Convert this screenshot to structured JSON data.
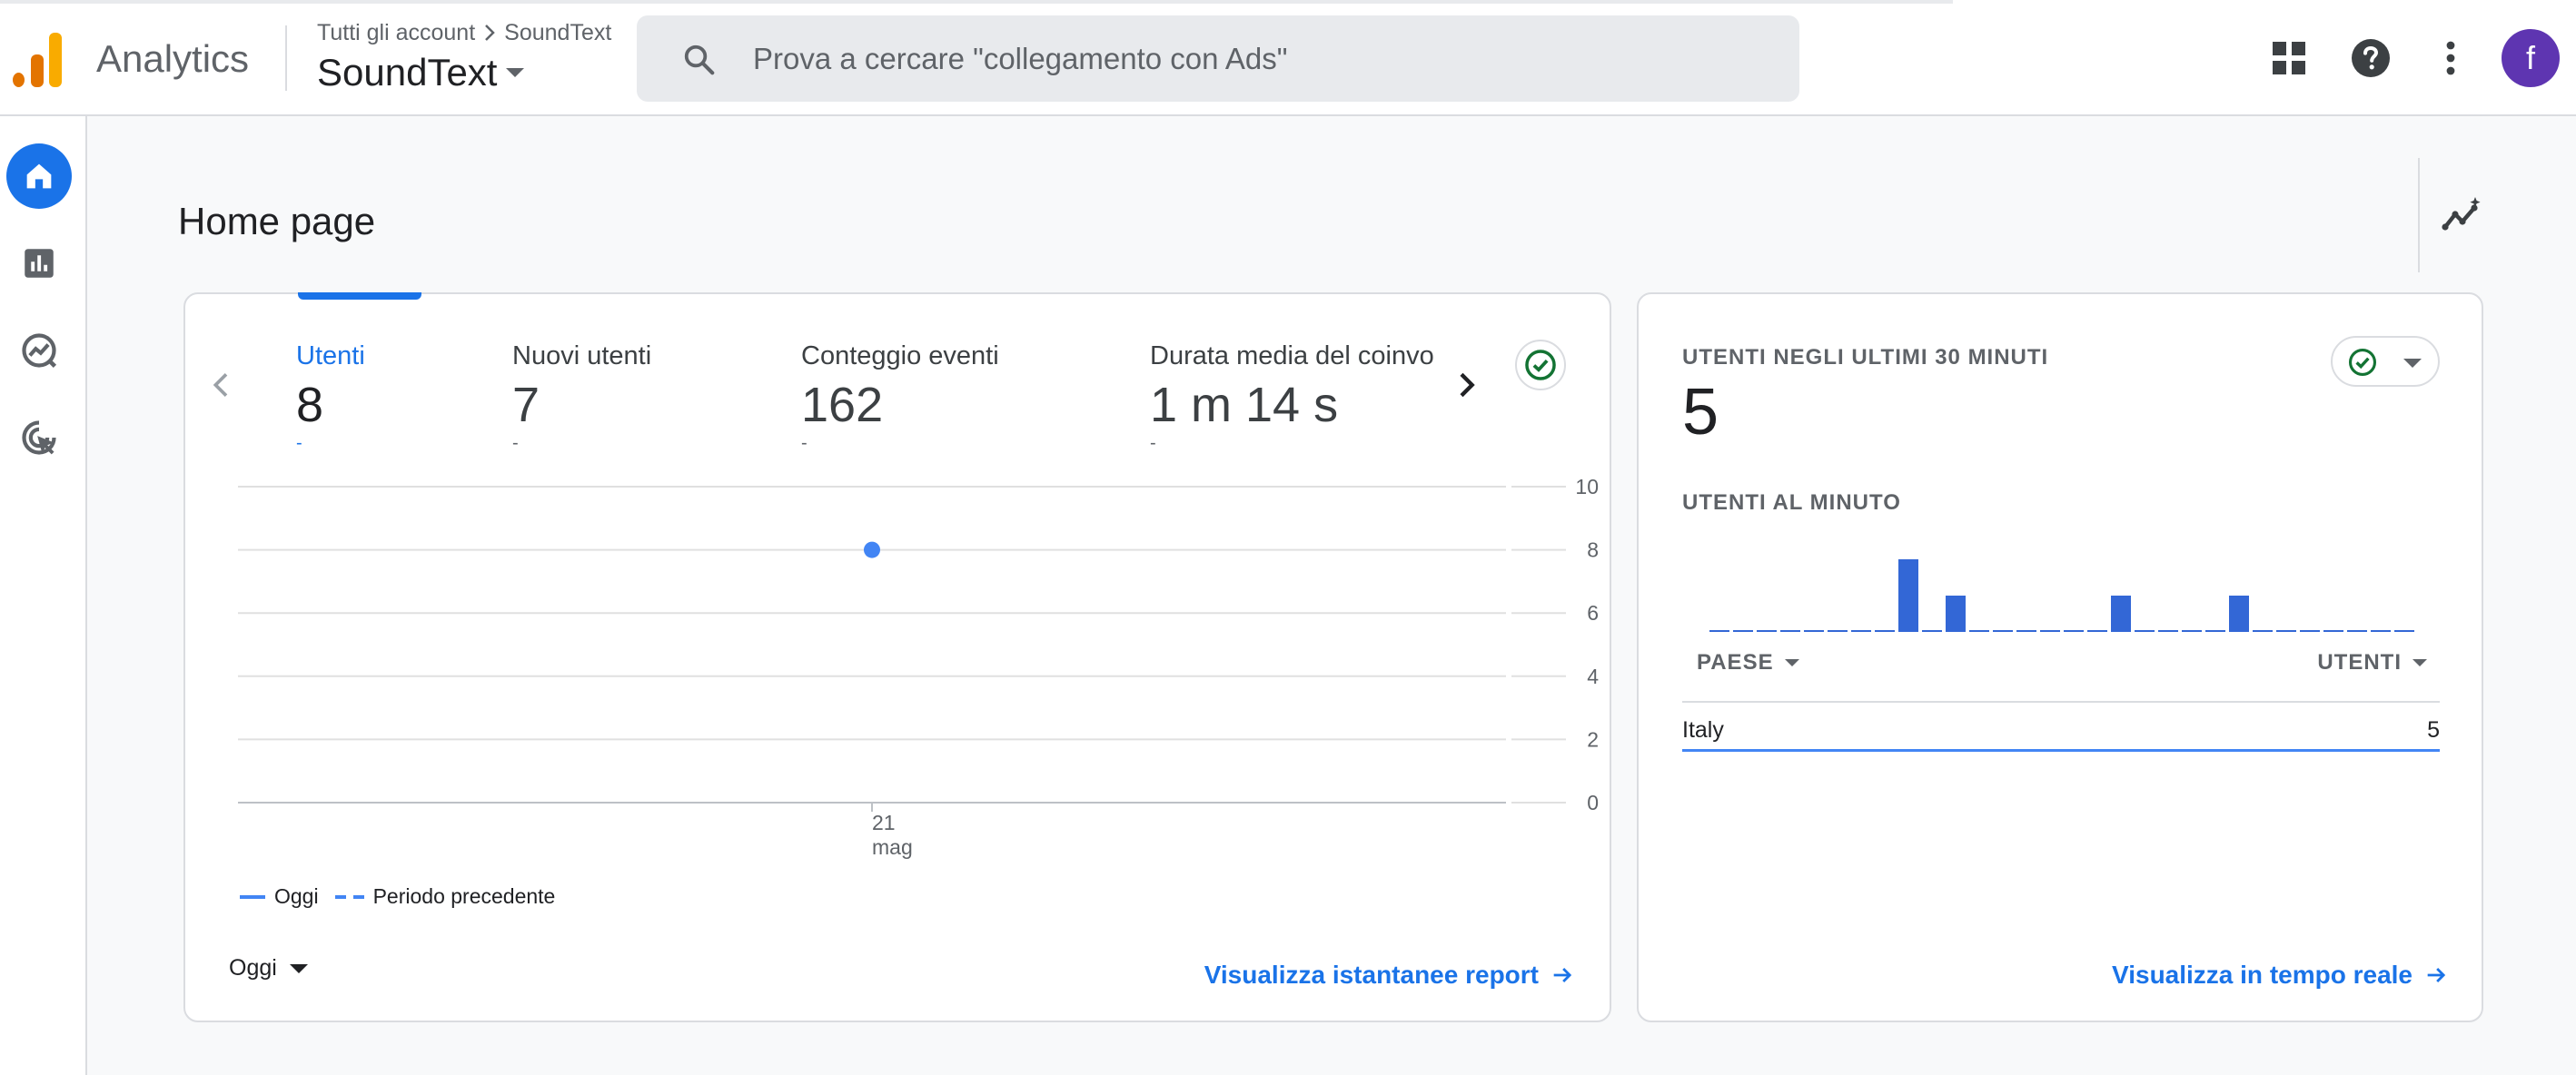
{
  "app": {
    "name": "Analytics",
    "breadcrumb_account": "Tutti gli account",
    "breadcrumb_property": "SoundText",
    "property_name": "SoundText",
    "avatar_letter": "f"
  },
  "search": {
    "placeholder": "Prova a cercare \"collegamento con Ads\""
  },
  "page": {
    "title": "Home page"
  },
  "metrics": [
    {
      "label": "Utenti",
      "value": "8",
      "change": "-"
    },
    {
      "label": "Nuovi utenti",
      "value": "7",
      "change": "-"
    },
    {
      "label": "Conteggio eventi",
      "value": "162",
      "change": "-"
    },
    {
      "label": "Durata media del coinvo",
      "value": "1 m 14 s",
      "change": "-"
    }
  ],
  "chart_data": [
    {
      "type": "line",
      "x": [
        "21 mag"
      ],
      "x_tick_lines": [
        "21",
        "mag"
      ],
      "series": [
        {
          "name": "Oggi",
          "values": [
            8
          ]
        },
        {
          "name": "Periodo precedente",
          "values": []
        }
      ],
      "yticks": [
        0,
        2,
        4,
        6,
        8,
        10
      ],
      "ylim": [
        0,
        10
      ],
      "grid": true,
      "legend": "bottom-left"
    },
    {
      "type": "bar",
      "title": "UTENTI AL MINUTO",
      "values": [
        0,
        0,
        0,
        0,
        0,
        0,
        0,
        0,
        2,
        0,
        1,
        0,
        0,
        0,
        0,
        0,
        0,
        1,
        0,
        0,
        0,
        0,
        1,
        0,
        0,
        0,
        0,
        0,
        0,
        0
      ]
    }
  ],
  "legend": {
    "current": "Oggi",
    "previous": "Periodo precedente"
  },
  "period_select": "Oggi",
  "report_link": "Visualizza istantanee report",
  "realtime": {
    "heading": "UTENTI NEGLI ULTIMI 30 MINUTI",
    "value": "5",
    "per_minute_label": "UTENTI AL MINUTO",
    "col_country": "PAESE",
    "col_users": "UTENTI",
    "rows": [
      {
        "country": "Italy",
        "users": "5"
      }
    ],
    "link": "Visualizza in tempo reale"
  },
  "colors": {
    "accent": "#1a73e8",
    "series": "#4285f4",
    "bar": "#3367d6",
    "check": "#137333"
  },
  "icons": [
    "search-icon",
    "apps-grid-icon",
    "help-icon",
    "more-vert-icon",
    "home-icon",
    "reports-icon",
    "explore-icon",
    "advertising-icon",
    "insights-icon",
    "chevron-left-icon",
    "chevron-right-icon",
    "check-circle-icon",
    "arrow-right-icon"
  ]
}
